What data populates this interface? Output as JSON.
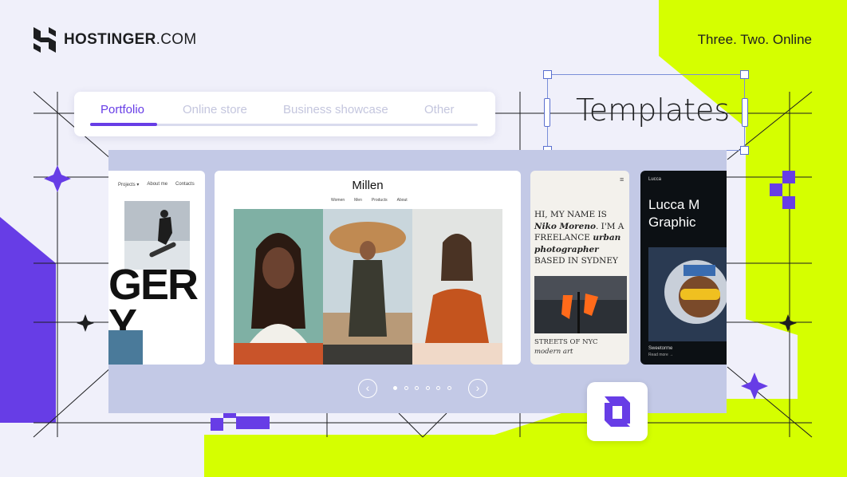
{
  "brand": {
    "name_bold": "HOSTINGER",
    "name_thin": ".COM"
  },
  "tagline": "Three. Two. Online",
  "tabs": [
    {
      "label": "Portfolio",
      "active": true
    },
    {
      "label": "Online store",
      "active": false
    },
    {
      "label": "Business showcase",
      "active": false
    },
    {
      "label": "Other",
      "active": false
    }
  ],
  "templates_label": "Templates",
  "cards": {
    "left": {
      "nav": [
        "Projects ▾",
        "About me",
        "Contacts"
      ],
      "big_text_1": "GER",
      "big_text_2": "Y"
    },
    "millen": {
      "title": "Millen",
      "nav": [
        "Women",
        "Men",
        "Products",
        "About"
      ]
    },
    "niko": {
      "intro_1": "HI, MY NAME IS ",
      "intro_name": "Niko Moreno",
      "intro_2": ". I'M A FREELANCE ",
      "intro_role": "urban photographer",
      "intro_3": " BASED IN SYDNEY",
      "caption_1": "STREETS OF NYC",
      "caption_2": "modern art",
      "menu_icon": "hamburger-icon"
    },
    "lucca": {
      "small": "Lucca",
      "title_1": "Lucca M",
      "title_2": "Graphic",
      "footer_1": "Sweetorme",
      "footer_2": "Read more →"
    }
  },
  "pager": {
    "dots": 6,
    "active_index": 0,
    "prev_icon": "chevron-left-icon",
    "next_icon": "chevron-right-icon"
  },
  "colors": {
    "accent": "#673de6",
    "lime": "#d5ff00",
    "panel": "#c3c9e6",
    "ink": "#1d1e20"
  }
}
